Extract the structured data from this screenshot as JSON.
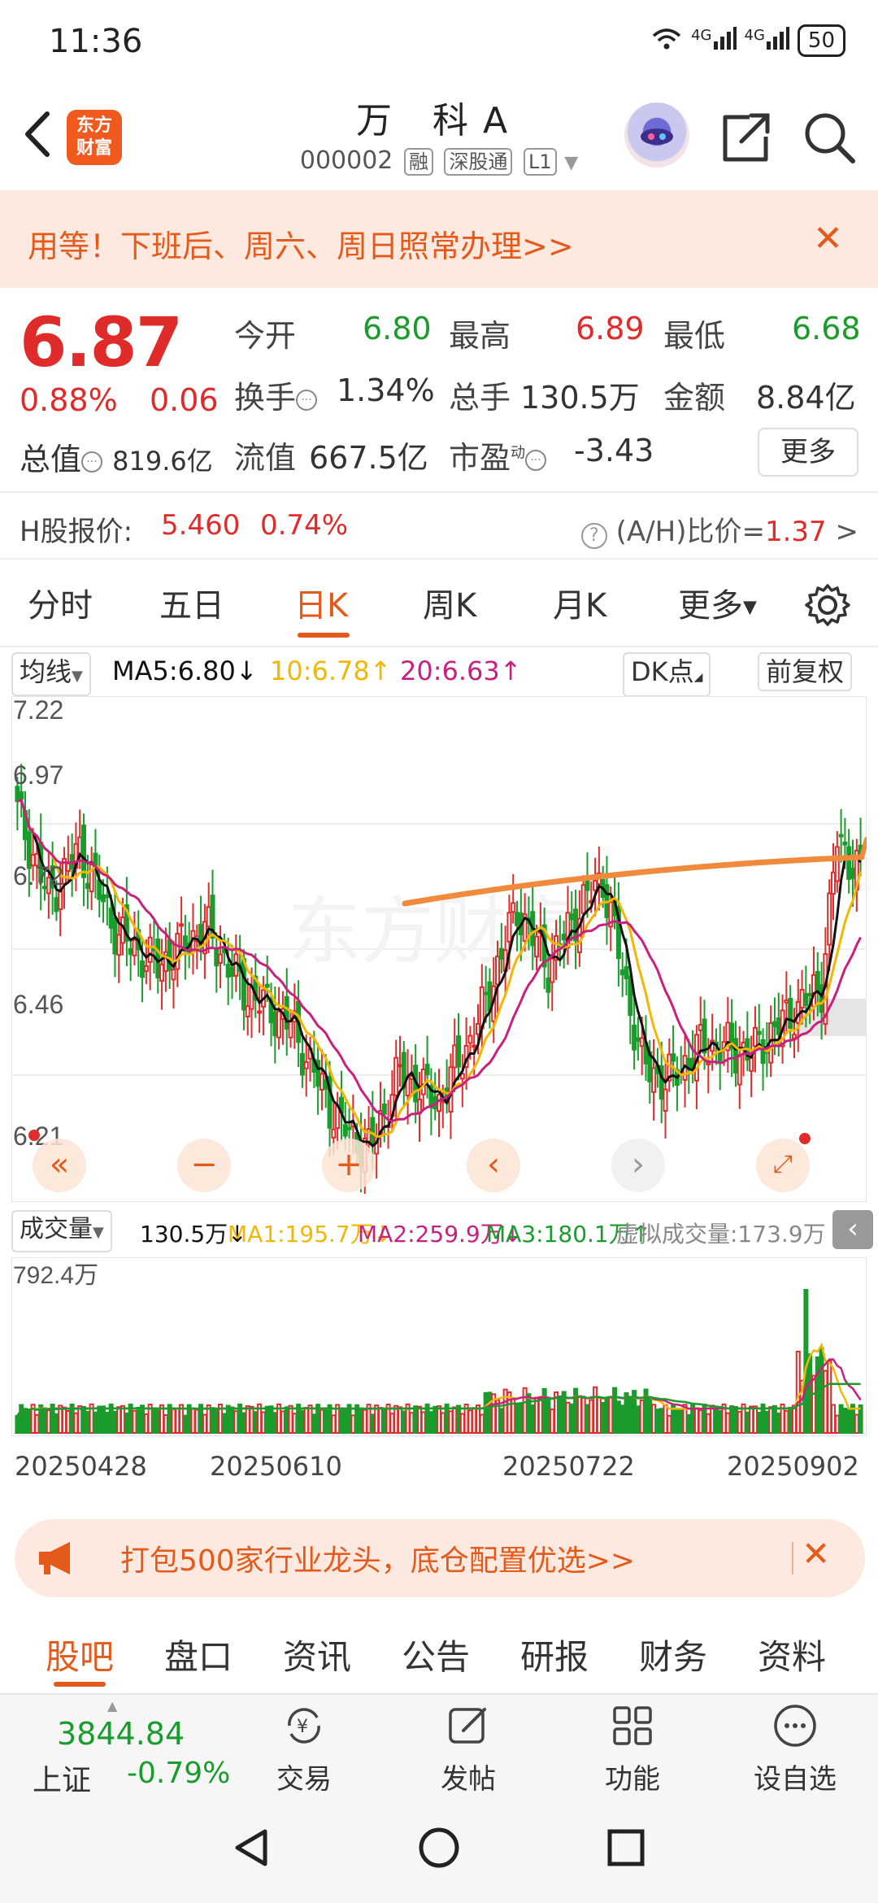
{
  "status_bar": {
    "time": "11:36",
    "signal_1": "4G",
    "signal_2": "4G",
    "battery": "50"
  },
  "header": {
    "logo_line1": "东方",
    "logo_line2": "财富",
    "stock_name": "万 科A",
    "stock_code": "000002",
    "tags": [
      "融",
      "深股通",
      "L1"
    ],
    "icons": [
      "back-arrow-icon",
      "assistant-robot-icon",
      "share-icon",
      "search-icon"
    ]
  },
  "promo_banner": {
    "text": "用等！下班后、周六、周日照常办理>>",
    "close": "✕"
  },
  "quote": {
    "price": "6.87",
    "change_pct": "0.88%",
    "change_abs": "0.06",
    "total_value_label": "总值",
    "total_value": "819.6亿",
    "open_label": "今开",
    "open": "6.80",
    "high_label": "最高",
    "high": "6.89",
    "low_label": "最低",
    "low": "6.68",
    "turnover_label": "换手",
    "turnover": "1.34%",
    "volume_label": "总手",
    "volume": "130.5万",
    "amount_label": "金额",
    "amount": "8.84亿",
    "float_label": "流值",
    "float_value": "667.5亿",
    "pe_label": "市盈",
    "pe_sup": "动",
    "pe": "-3.43",
    "more_button": "更多"
  },
  "h_share": {
    "label": "H股报价:",
    "price": "5.460",
    "pct": "0.74%",
    "ratio_label": "(A/H)比价=",
    "ratio_value": "1.37",
    "ratio_arrow": ">"
  },
  "chart_tabs": {
    "items": [
      "分时",
      "五日",
      "日K",
      "周K",
      "月K",
      "更多"
    ],
    "active": "日K"
  },
  "ma_bar": {
    "selector": "均线",
    "ma5": "MA5:6.80↓",
    "ma10": "10:6.78↑",
    "ma20": "20:6.63↑",
    "dk_button": "DK点",
    "adjust_button": "前复权"
  },
  "volume_bar": {
    "selector": "成交量",
    "vol": "130.5万↓",
    "ma1": "MA1:195.7万↓",
    "ma2": "MA2:259.9万↓",
    "ma3": "MA3:180.1万↑",
    "virtual": "虚拟成交量:173.9万",
    "vol_max_label": "792.4万"
  },
  "chart_data": {
    "type": "candlestick",
    "y_ticks": [
      "7.22",
      "6.97",
      "6.72",
      "6.46",
      "6.21"
    ],
    "ylim": [
      6.21,
      7.22
    ],
    "x_labels": [
      "20250428",
      "20250610",
      "20250722",
      "20250902"
    ],
    "colors": {
      "up": "#e02b2b",
      "down": "#1a9c2c",
      "ma5": "#111111",
      "ma10": "#f2b705",
      "ma20": "#c8207e",
      "trendline": "#f08a3c"
    },
    "waypoints": [
      7.0,
      6.82,
      6.92,
      6.74,
      6.68,
      6.76,
      6.63,
      6.56,
      6.36,
      6.3,
      6.46,
      6.4,
      6.56,
      6.8,
      6.68,
      6.8,
      6.86,
      6.48,
      6.44,
      6.52,
      6.5,
      6.58,
      6.64,
      6.94,
      6.87
    ],
    "counts": [
      8,
      8,
      10,
      10,
      12,
      10,
      12,
      12,
      8,
      8,
      10,
      10,
      10,
      8,
      8,
      6,
      10,
      6,
      10,
      12,
      10,
      8,
      4,
      6
    ]
  },
  "promo2": {
    "text": "打包500家行业龙头，底仓配置优选>>",
    "close": "✕"
  },
  "section_tabs": {
    "items": [
      "股吧",
      "盘口",
      "资讯",
      "公告",
      "研报",
      "财务",
      "资料"
    ],
    "active": "股吧"
  },
  "toolbar": {
    "index_value": "3844.84",
    "index_name": "上证",
    "index_pct": "-0.79%",
    "trade": "交易",
    "post": "发帖",
    "functions": "功能",
    "watchlist": "设自选"
  }
}
